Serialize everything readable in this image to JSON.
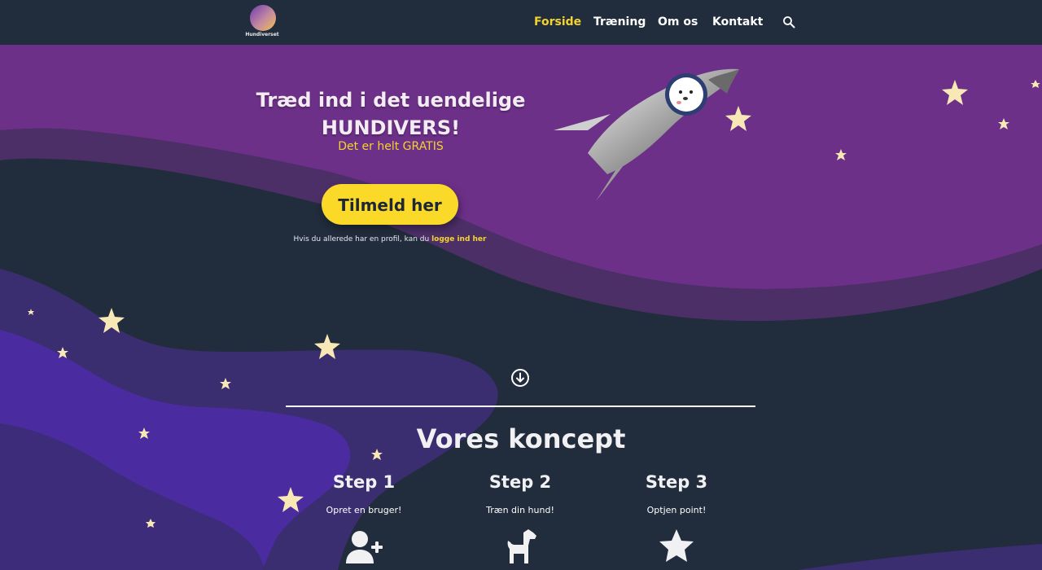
{
  "header": {
    "logo_text": "Hundiverset",
    "nav": [
      "Forside",
      "Træning",
      "Om os",
      "Kontakt"
    ],
    "active_nav": "Forside",
    "search_icon": "search-icon"
  },
  "hero": {
    "title_line1": "Træd ind i det uendelige",
    "title_line2": "HUNDIVERS!",
    "subtitle": "Det er helt GRATIS",
    "cta_label": "Tilmeld her",
    "login_prefix": "Hvis du allerede har en profil, kan du ",
    "login_link": "logge ind her"
  },
  "scroll_icon": "arrow-down-circle-icon",
  "concept": {
    "title": "Vores koncept",
    "steps": [
      {
        "title": "Step 1",
        "text": "Opret en bruger!",
        "icon": "user-plus-icon"
      },
      {
        "title": "Step 2",
        "text": "Træn din hund!",
        "icon": "dog-icon"
      },
      {
        "title": "Step 3",
        "text": "Optjen point!",
        "icon": "star-icon"
      }
    ]
  },
  "colors": {
    "navy": "#212c3c",
    "purple": "#6c3088",
    "accent_yellow": "#f5d32e",
    "star": "#f7e8b5"
  }
}
